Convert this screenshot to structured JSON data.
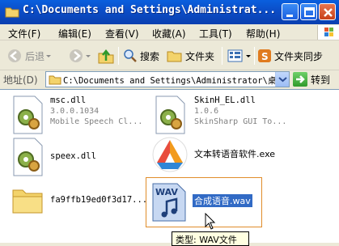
{
  "window": {
    "title": "C:\\Documents and Settings\\Administrat..."
  },
  "menu": {
    "items": [
      "文件(F)",
      "编辑(E)",
      "查看(V)",
      "收藏(A)",
      "工具(T)",
      "帮助(H)"
    ]
  },
  "toolbar": {
    "back_label": "后退",
    "search_label": "搜索",
    "folders_label": "文件夹",
    "sync_label": "文件夹同步"
  },
  "address": {
    "label": "地址(D)",
    "value": "C:\\Documents and Settings\\Administrator\\桌面",
    "go_label": "转到"
  },
  "files": [
    {
      "name": "msc.dll",
      "version": "3.0.0.1034",
      "desc": "Mobile Speech Cl...",
      "icon": "dll-gear-icon"
    },
    {
      "name": "SkinH_EL.dll",
      "version": "1.0.6",
      "desc": "SkinSharp GUI To...",
      "icon": "dll-gear-icon"
    },
    {
      "name": "speex.dll",
      "icon": "dll-gear-icon"
    },
    {
      "name": "文本转语音软件.exe",
      "icon": "app-logo-icon"
    },
    {
      "name": "fa9ffb19ed0f3d17...",
      "icon": "folder-icon"
    },
    {
      "name": "合成语音.wav",
      "icon": "wav-audio-icon",
      "selected": true
    }
  ],
  "tooltip": {
    "text": "类型: WAV文件"
  },
  "colors": {
    "titlebar": "#0A4DC7",
    "selection": "#316AC5",
    "window_bg": "#ECE9D8"
  }
}
